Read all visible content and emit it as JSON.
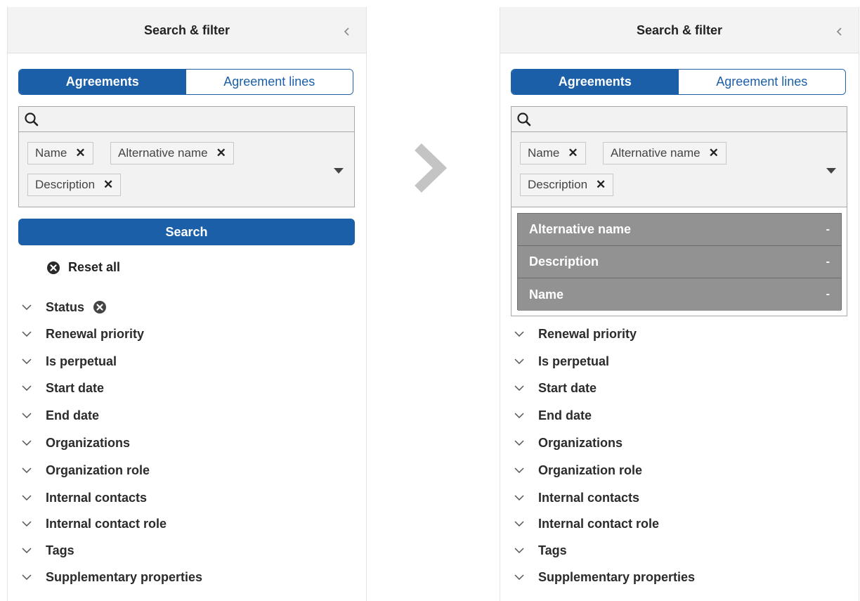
{
  "left": {
    "header": {
      "title": "Search & filter"
    },
    "tabs": [
      "Agreements",
      "Agreement lines"
    ],
    "search": {
      "query": "",
      "chips": [
        "Name",
        "Alternative name",
        "Description"
      ]
    },
    "search_button": "Search",
    "reset_all": "Reset all",
    "filters": [
      "Status",
      "Renewal priority",
      "Is perpetual",
      "Start date",
      "End date",
      "Organizations",
      "Organization role",
      "Internal contacts",
      "Internal contact role",
      "Tags",
      "Supplementary properties"
    ]
  },
  "right": {
    "header": {
      "title": "Search & filter"
    },
    "tabs": [
      "Agreements",
      "Agreement lines"
    ],
    "search": {
      "query": "",
      "chips": [
        "Name",
        "Alternative name",
        "Description"
      ]
    },
    "menu": [
      {
        "label": "Alternative name",
        "mark": "-"
      },
      {
        "label": "Description",
        "mark": "-"
      },
      {
        "label": "Name",
        "mark": "-"
      }
    ],
    "filters": [
      "Renewal priority",
      "Is perpetual",
      "Start date",
      "End date",
      "Organizations",
      "Organization role",
      "Internal contacts",
      "Internal contact role",
      "Tags",
      "Supplementary properties"
    ]
  },
  "icons": {
    "collapse": "chevron-left-icon",
    "search": "search-icon",
    "remove": "close-icon",
    "dropdown": "caret-down-icon",
    "reset": "clear-circle-icon",
    "filter": "chevron-down-icon",
    "separator": "chevron-right-icon"
  },
  "colors": {
    "accent": "#1a5fa8",
    "menu_bg": "#929292",
    "header_bg": "#f3f3f3"
  }
}
